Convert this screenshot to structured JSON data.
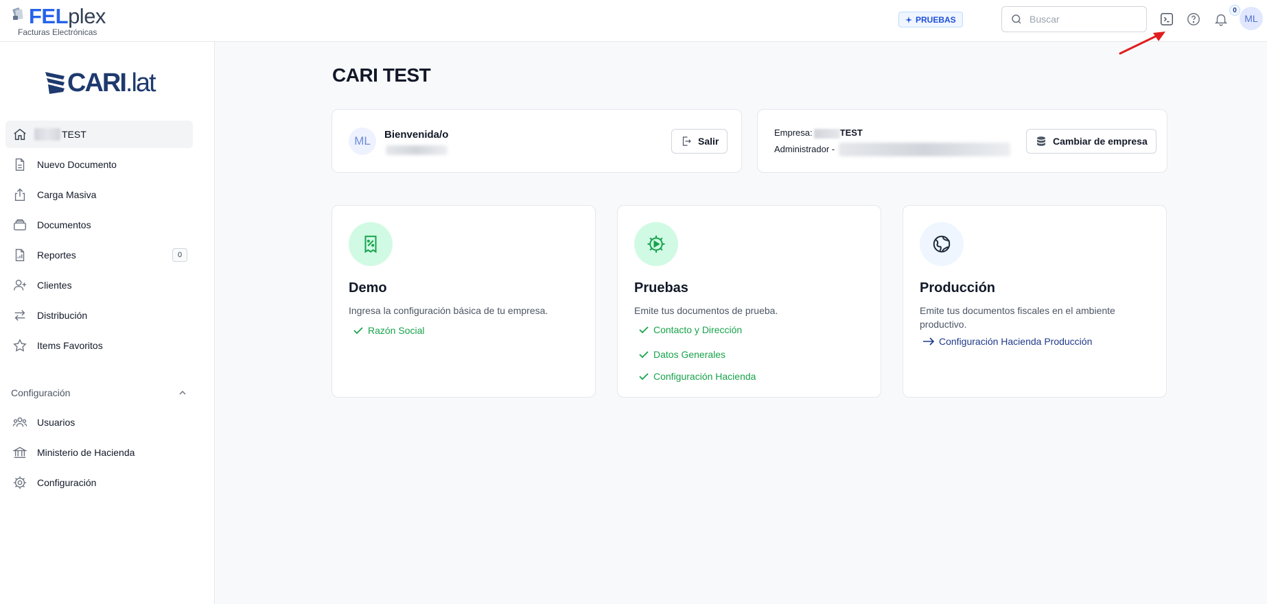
{
  "app": {
    "logo_brand": "FEL",
    "logo_brand_suffix": "plex",
    "logo_subtitle": "Facturas Electrónicas"
  },
  "topbar": {
    "environment_badge": "PRUEBAS",
    "search_placeholder": "Buscar",
    "notification_count": "0",
    "avatar_initials": "ML"
  },
  "sidebar": {
    "brand": "CARI",
    "brand_suffix": ".lat",
    "items": [
      {
        "label": "TEST",
        "icon": "home-icon",
        "active": true
      },
      {
        "label": "Nuevo Documento",
        "icon": "document-icon"
      },
      {
        "label": "Carga Masiva",
        "icon": "upload-icon"
      },
      {
        "label": "Documentos",
        "icon": "inbox-icon"
      },
      {
        "label": "Reportes",
        "icon": "report-icon",
        "count": "0"
      },
      {
        "label": "Clientes",
        "icon": "user-add-icon"
      },
      {
        "label": "Distribución",
        "icon": "arrows-icon"
      },
      {
        "label": "Items Favoritos",
        "icon": "star-icon"
      }
    ],
    "section_title": "Configuración",
    "config_items": [
      {
        "label": "Usuarios",
        "icon": "users-icon"
      },
      {
        "label": "Ministerio de Hacienda",
        "icon": "bank-icon"
      },
      {
        "label": "Configuración",
        "icon": "gear-icon"
      }
    ]
  },
  "main": {
    "title": "CARI TEST",
    "welcome": {
      "avatar_initials": "ML",
      "title": "Bienvenida/o",
      "logout_label": "Salir"
    },
    "company": {
      "empresa_label": "Empresa:",
      "empresa_name": "TEST",
      "role_label": "Administrador -",
      "change_label": "Cambiar de empresa"
    },
    "stages": [
      {
        "title": "Demo",
        "description": "Ingresa la configuración básica de tu empresa.",
        "checks": [
          "Razón Social"
        ]
      },
      {
        "title": "Pruebas",
        "description": "Emite tus documentos de prueba.",
        "checks": [
          "Contacto y Dirección",
          "Datos Generales",
          "Configuración Hacienda"
        ]
      },
      {
        "title": "Producción",
        "description": "Emite tus documentos fiscales en el ambiente productivo.",
        "link": "Configuración Hacienda Producción"
      }
    ]
  },
  "colors": {
    "accent": "#2563eb",
    "success": "#16a34a",
    "navy": "#1e3a8a",
    "annotation_arrow": "#e11d1d"
  }
}
